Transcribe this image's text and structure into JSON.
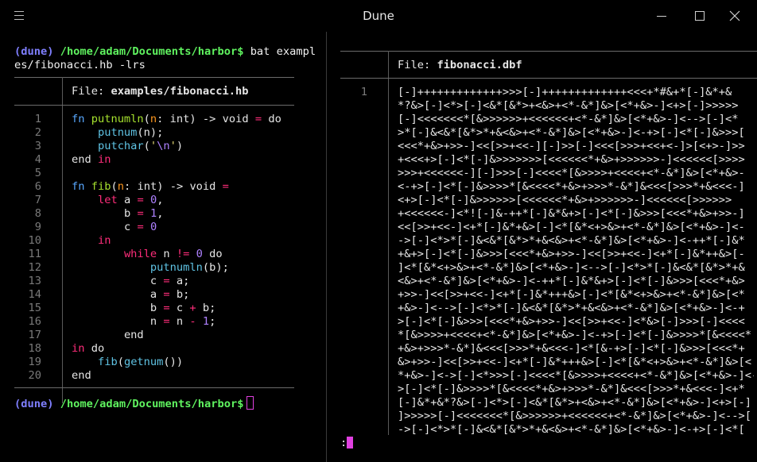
{
  "window": {
    "title": "Dune"
  },
  "left": {
    "prompt": {
      "venv": "(dune)",
      "path": "/home/adam/Documents/harbor$",
      "command_line1": " bat exampl",
      "command_line2": "es/fibonacci.hb -lrs"
    },
    "file_label": "File: ",
    "file_name": "examples/fibonacci.hb",
    "line_numbers": [
      "1",
      "2",
      "3",
      "4",
      "5",
      "6",
      "7",
      "8",
      "9",
      "10",
      "11",
      "12",
      "13",
      "14",
      "15",
      "16",
      "17",
      "18",
      "19",
      "20"
    ],
    "code_lines": [
      "fn putnumln(n: int) -> void = do",
      "    putnum(n);",
      "    putchar('\\n')",
      "end in",
      "",
      "fn fib(n: int) -> void =",
      "    let a = 0,",
      "        b = 1,",
      "        c = 0",
      "    in",
      "        while n != 0 do",
      "            putnumln(b);",
      "            c = a;",
      "            a = b;",
      "            b = c + b;",
      "            n = n - 1;",
      "        end",
      "in do",
      "    fib(getnum())",
      "end"
    ],
    "prompt2": {
      "venv": "(dune)",
      "path": "/home/adam/Documents/harbor$"
    }
  },
  "right": {
    "file_label": "File: ",
    "file_name": "fibonacci.dbf",
    "line_number": "1",
    "bf_lines": [
      "[-]+++++++++++++>>>[-]+++++++++++++<<<+*#&+*[-]&*+&",
      "*?&>[-]<*>[-]<&*[&*>+<&>+<*-&*]&>[<*+&>-]<+>[-]>>>>>",
      "[-]<<<<<<<*[&>>>>>>+<<<<<<+<*-&*]&>[<*+&>-]<-->[-]<*",
      ">*[-]&<&*[&*>*+&<&>+<*-&*]&>[<*+&>-]<-+>[-]<*[-]&>>>[",
      "<<<*+&>+>>-]<<[>>+<<-][-]>>[-]<<<[>>>+<<+<-]>[<+>-]>>",
      "+<<<+>[-]<*[-]&>>>>>>>[<<<<<<*+&>+>>>>>>-]<<<<<<[>>>>",
      ">>>+<<<<<<-][-]>>>[-]<<<<*[&>>>>+<<<<+<*-&*]&>[<*+&>-",
      "<-+>[-]<*[-]&>>>>*[&<<<<*+&>+>>>*-&*]&<<<[>>>*+&<<<-]",
      "<+>[-]<*[-]&>>>>>>[<<<<<<*+&>+>>>>>>-]<<<<<<[>>>>>>",
      "+<<<<<<-]<*![-]&-++*[-]&*&+>[-]<*[-]&>>>[<<<*+&>+>>-]",
      "<<[>>+<<-]<+*[-]&*+&>[-]<*[&*<+>&>+<*-&*]&>[<*+&>-]<-",
      "->[-]<*>*[-]&<&*[&*>*+&<&>+<*-&*]&>[<*+&>-]<-++*[-]&*",
      "+&+>[-]<*[-]&>>>[<<<*+&>+>>-]<<[>>+<<-]<+*[-]&*++&>[-",
      "]<*[&*<+>&>+<*-&*]&>[<*+&>-]<-->[-]<*>*[-]&<&*[&*>*+&",
      "<&>+<*-&*]&>[<*+&>-]<-++*[-]&*&+>[-]<*[-]&>>>[<<<*+&>",
      "+>>-]<<[>>+<<-]<+*[-]&*+++&>[-]<*[&*<+>&>+<*-&*]&>[<*",
      "+&>-]<-->[-]<*>*[-]&<&*[&*>*+&<&>+<*-&*]&>[<*+&>-]<-+",
      ">[-]<*[-]&>>>[<<<*+&>+>>-]<<[>>+<<-]<*&>[-]>>>[-]<<<<",
      "*[&>>>>+<<<<+<*-&*]&>[<*+&>-]<-+>[-]<*[-]&>>>>*[&<<<<*",
      "+&>+>>>*-&*]&<<<[>>>*+&<<<-]<*[&-+>[-]<*[-]&>>>[<<<*+",
      "&>+>>-]<<[>>+<<-]<+*[-]&*+++&>[-]<*[&*<+>&>+<*-&*]&>[<",
      "*+&>-]<->[-]<*>>>[-]<<<<*[&>>>>+<<<<+<*-&*]&>[<*+&>-]<-+",
      ">[-]<*[-]&>>>>*[&<<<<*+&>+>>>*-&*]&<<<[>>>*+&<<<-]<+*",
      "[-]&*+&*?&>[-]<*>[-]<&*[&*>+<&>+<*-&*]&>[<*+&>-]<+>[-]",
      "]>>>>>[-]<<<<<<<*[&>>>>>>+<<<<<<+<*-&*]&>[<*+&>-]<-->[",
      "->[-]<*>*[-]&<&*[&*>*+&<&>+<*-&*]&>[<*+&>-]<-+>[-]<*["
    ],
    "pager_prompt": ":"
  }
}
